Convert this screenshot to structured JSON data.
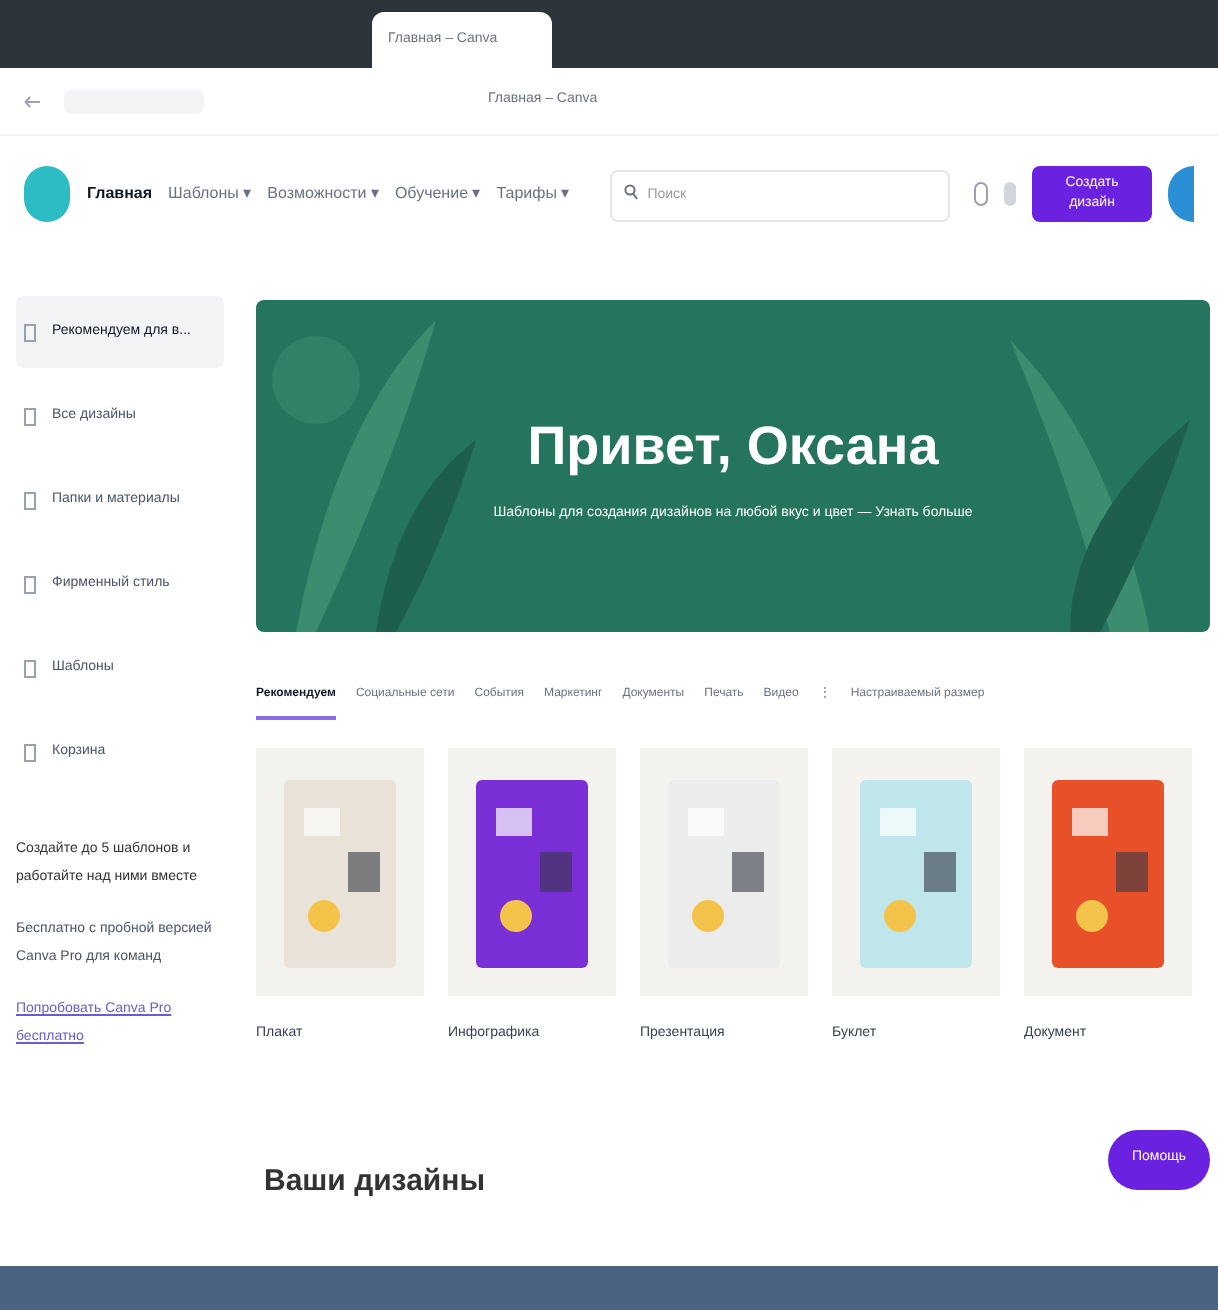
{
  "browser": {
    "tab_title": "Главная – Canva",
    "page_title": "Главная – Canva"
  },
  "header": {
    "nav": [
      {
        "label": "Главная",
        "selected": true
      },
      {
        "label": "Шаблоны ▾",
        "selected": false
      },
      {
        "label": "Возможности ▾",
        "selected": false
      },
      {
        "label": "Обучение ▾",
        "selected": false
      },
      {
        "label": "Тарифы ▾",
        "selected": false
      }
    ],
    "search": {
      "placeholder": "Поиск"
    },
    "create_button": "Создать дизайн"
  },
  "sidebar": {
    "items": [
      {
        "label": "Рекомендуем для в...",
        "selected": true
      },
      {
        "label": "Все дизайны",
        "selected": false
      },
      {
        "label": "Папки и материалы",
        "selected": false
      },
      {
        "label": "Фирменный стиль",
        "selected": false
      },
      {
        "label": "Шаблоны",
        "selected": false
      },
      {
        "label": "Корзина",
        "selected": false
      }
    ],
    "promo": {
      "title": "Создайте до 5 шаблонов и работайте над ними вместе",
      "text": "Бесплатно с пробной версией Canva Pro для команд",
      "link": "Попробовать Canva Pro бесплатно"
    }
  },
  "hero": {
    "title": "Привет, Оксана",
    "subtitle": "Шаблоны для создания дизайнов на любой вкус и цвет — Узнать больше"
  },
  "tabs": [
    {
      "label": "Рекомендуем",
      "selected": true
    },
    {
      "label": "Социальные сети",
      "selected": false
    },
    {
      "label": "События",
      "selected": false
    },
    {
      "label": "Маркетинг",
      "selected": false
    },
    {
      "label": "Документы",
      "selected": false
    },
    {
      "label": "Печать",
      "selected": false
    },
    {
      "label": "Видео",
      "selected": false
    },
    {
      "label": "⋮",
      "selected": false
    },
    {
      "label": "Настраиваемый размер",
      "selected": false
    }
  ],
  "cards": [
    {
      "label": "Плакат",
      "color": "#e8e2d8"
    },
    {
      "label": "Инфографика",
      "color": "#7a2ed6"
    },
    {
      "label": "Презентация",
      "color": "#ececec"
    },
    {
      "label": "Буклет",
      "color": "#bfe6ea"
    },
    {
      "label": "Документ",
      "color": "#e8502a"
    }
  ],
  "section_title": "Ваши дизайны",
  "help_button": "Помощь"
}
